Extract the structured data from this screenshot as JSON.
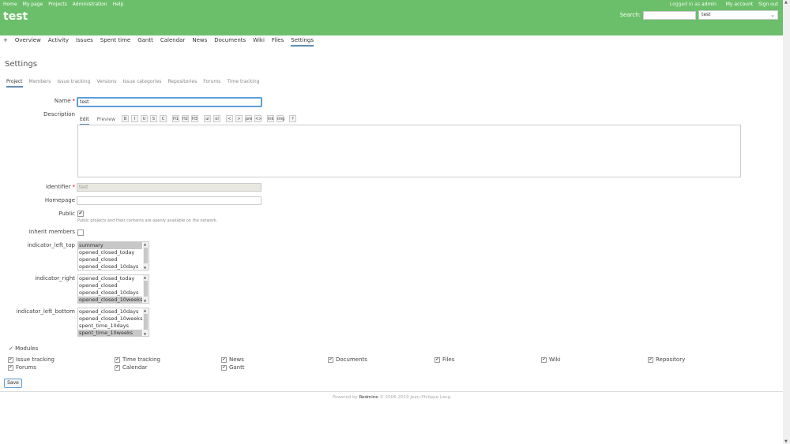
{
  "top_menu": [
    "Home",
    "My page",
    "Projects",
    "Administration",
    "Help"
  ],
  "account": {
    "logged_in_prefix": "Logged in as",
    "user": "admin",
    "my_account": "My account",
    "sign_out": "Sign out"
  },
  "project_title": "test",
  "search": {
    "label": "Search:",
    "value": "",
    "jump_value": "test"
  },
  "main_menu": [
    {
      "label": "+"
    },
    {
      "label": "Overview"
    },
    {
      "label": "Activity"
    },
    {
      "label": "Issues"
    },
    {
      "label": "Spent time"
    },
    {
      "label": "Gantt"
    },
    {
      "label": "Calendar"
    },
    {
      "label": "News"
    },
    {
      "label": "Documents"
    },
    {
      "label": "Wiki"
    },
    {
      "label": "Files"
    },
    {
      "label": "Settings",
      "selected": true
    }
  ],
  "page_heading": "Settings",
  "settings_tabs": [
    "Project",
    "Members",
    "Issue tracking",
    "Versions",
    "Issue categories",
    "Repositories",
    "Forums",
    "Time tracking"
  ],
  "form": {
    "name_label": "Name",
    "name_value": "test",
    "description_label": "Description",
    "desc_tabs": [
      "Edit",
      "Preview"
    ],
    "toolbar": [
      "B",
      "I",
      "U",
      "S",
      "C",
      "H1",
      "H2",
      "H3",
      "ul",
      "ol",
      "&lt;",
      "&gt;",
      "pre",
      "&lt;&gt;",
      "lnk",
      "img",
      "?"
    ],
    "identifier_label": "Identifier",
    "identifier_value": "test",
    "homepage_label": "Homepage",
    "homepage_value": "",
    "public_label": "Public",
    "public_checked": true,
    "public_hint": "Public projects and their contents are openly available on the network.",
    "inherit_label": "Inherit members",
    "inherit_checked": false,
    "lists": [
      {
        "label": "indicator_left_top",
        "options": [
          "summary",
          "opened_closed_today",
          "opened_closed",
          "opened_closed_10days"
        ],
        "selected": [
          0
        ]
      },
      {
        "label": "indicator_right",
        "options": [
          "opened_closed_today",
          "opened_closed",
          "opened_closed_10days",
          "opened_closed_10weeks"
        ],
        "selected": [
          3
        ]
      },
      {
        "label": "indicator_left_bottom",
        "options": [
          "opened_closed_10days",
          "opened_closed_10weeks",
          "spent_time_10days",
          "spent_time_10weeks"
        ],
        "selected": [
          3
        ]
      }
    ]
  },
  "modules": {
    "legend": "Modules",
    "items": [
      {
        "label": "Issue tracking",
        "checked": true
      },
      {
        "label": "Time tracking",
        "checked": true
      },
      {
        "label": "News",
        "checked": true
      },
      {
        "label": "Documents",
        "checked": true
      },
      {
        "label": "Files",
        "checked": true
      },
      {
        "label": "Wiki",
        "checked": true
      },
      {
        "label": "Repository",
        "checked": true
      },
      {
        "label": "Forums",
        "checked": true
      },
      {
        "label": "Calendar",
        "checked": true
      },
      {
        "label": "Gantt",
        "checked": true
      }
    ]
  },
  "save_label": "Save",
  "footer": {
    "prefix": "Powered by",
    "brand": "Redmine",
    "suffix": "© 2006-2019 Jean-Philippe Lang"
  },
  "colors": {
    "header": "#6cbf6a",
    "accent": "#628db6",
    "focus": "#5b9fd8"
  }
}
